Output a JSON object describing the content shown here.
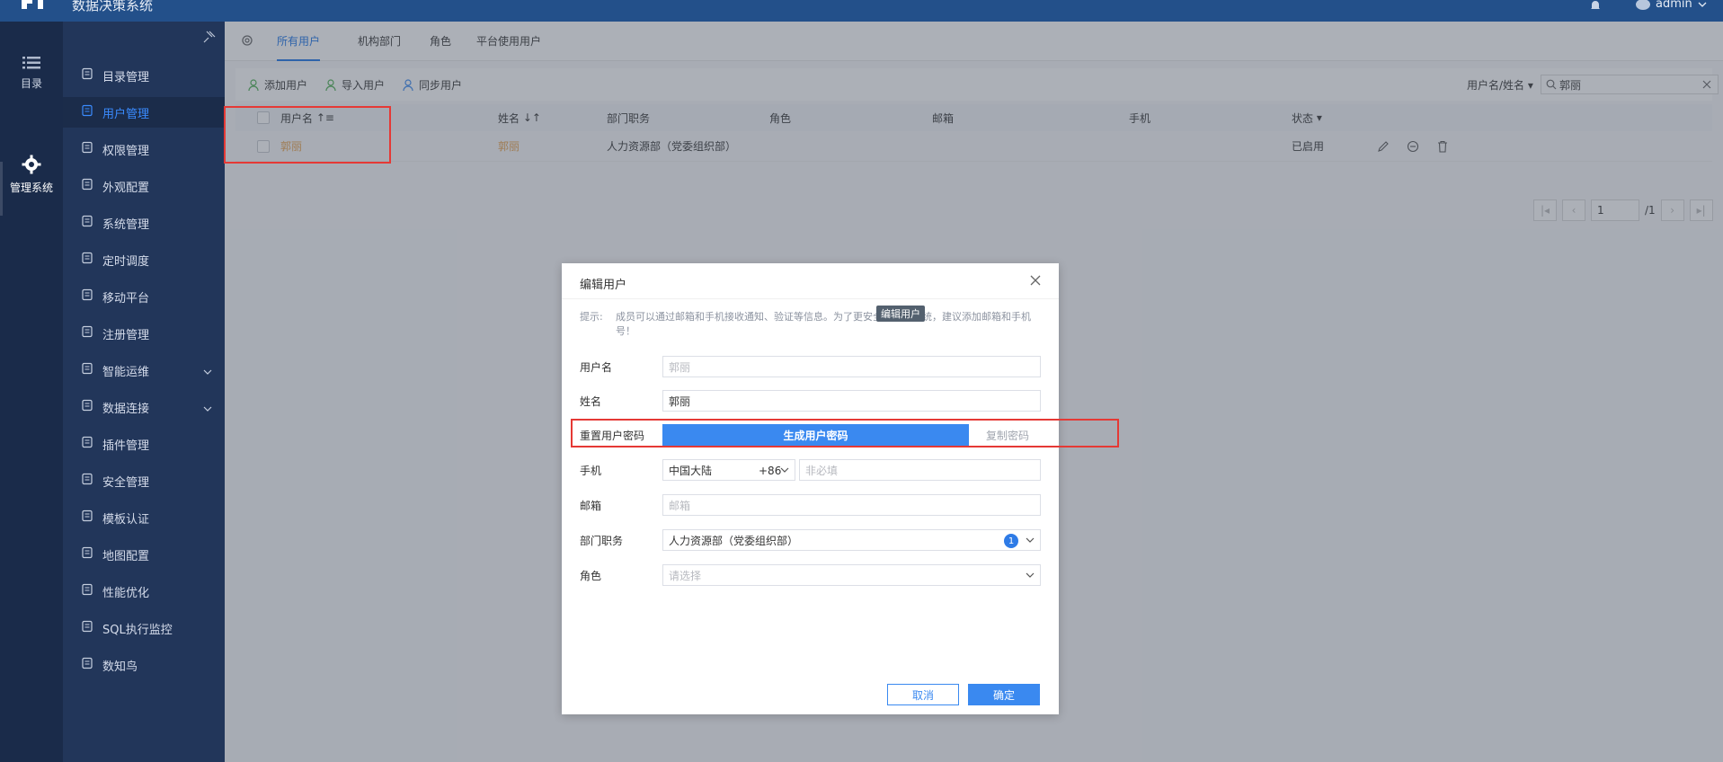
{
  "app": {
    "title": "数据决策系统",
    "username": "admin"
  },
  "rail": {
    "items": [
      {
        "label": "目录",
        "icon": "list-icon"
      },
      {
        "label": "管理系统",
        "icon": "gear-icon"
      }
    ]
  },
  "nav": {
    "items": [
      {
        "label": "目录管理",
        "icon": "catalog-icon"
      },
      {
        "label": "用户管理",
        "icon": "user-icon"
      },
      {
        "label": "权限管理",
        "icon": "lock-icon"
      },
      {
        "label": "外观配置",
        "icon": "brush-icon"
      },
      {
        "label": "系统管理",
        "icon": "settings-icon"
      },
      {
        "label": "定时调度",
        "icon": "timer-icon"
      },
      {
        "label": "移动平台",
        "icon": "mobile-icon"
      },
      {
        "label": "注册管理",
        "icon": "register-icon"
      },
      {
        "label": "智能运维",
        "icon": "ops-icon"
      },
      {
        "label": "数据连接",
        "icon": "link-icon"
      },
      {
        "label": "插件管理",
        "icon": "plugin-icon"
      },
      {
        "label": "安全管理",
        "icon": "shield-icon"
      },
      {
        "label": "模板认证",
        "icon": "template-icon"
      },
      {
        "label": "地图配置",
        "icon": "map-icon"
      },
      {
        "label": "性能优化",
        "icon": "performance-icon"
      },
      {
        "label": "SQL执行监控",
        "icon": "sql-icon"
      },
      {
        "label": "数知鸟",
        "icon": "bird-icon"
      }
    ],
    "active_index": 1
  },
  "tabs": [
    "所有用户",
    "机构部门",
    "角色",
    "平台使用用户"
  ],
  "toolbar": {
    "add": "添加用户",
    "import": "导入用户",
    "sync": "同步用户",
    "search_type": "用户名/姓名",
    "search_value": "郭丽"
  },
  "table": {
    "headers": [
      "用户名",
      "姓名",
      "部门职务",
      "角色",
      "邮箱",
      "手机",
      "状态"
    ],
    "rows": [
      {
        "username": "郭丽",
        "name": "郭丽",
        "dept": "人力资源部（党委组织部）",
        "role": "",
        "email": "",
        "phone": "",
        "status": "已启用"
      }
    ]
  },
  "pager": {
    "page": "1",
    "total": "/1"
  },
  "dialog": {
    "title": "编辑用户",
    "tip_label": "提示:",
    "tip_text": "成员可以通过邮箱和手机接收通知、验证等信息。为了更安全地使用系统，建议添加邮箱和手机号！",
    "tooltip": "编辑用户",
    "labels": {
      "username": "用户名",
      "name": "姓名",
      "reset_password": "重置用户密码",
      "phone": "手机",
      "email": "邮箱",
      "dept": "部门职务",
      "role": "角色"
    },
    "values": {
      "username": "郭丽",
      "name": "郭丽",
      "region": "中国大陆",
      "country_code": "+86",
      "dept": "人力资源部（党委组织部）",
      "dept_count": "1"
    },
    "placeholders": {
      "phone": "非必填",
      "email": "邮箱",
      "role": "请选择"
    },
    "buttons": {
      "generate": "生成用户密码",
      "copy": "复制密码",
      "cancel": "取消",
      "ok": "确定"
    }
  },
  "colors": {
    "accent": "#3a89f0",
    "highlight": "#e53935",
    "topbar": "#23508a",
    "sidebar": "#22365a"
  }
}
